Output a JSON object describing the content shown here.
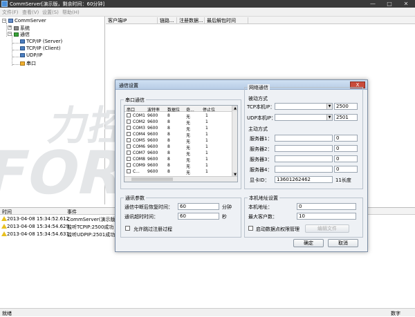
{
  "window": {
    "title": "CommServer[演示版，剩余时间：60分钟]",
    "minimize": "—",
    "maximize": "□",
    "close": "✕"
  },
  "menu": [
    "文件(F)",
    "查看(V)",
    "设置(S)",
    "帮助(H)"
  ],
  "tree": {
    "root": "CommServer",
    "system": "系统",
    "comm": "通信",
    "tcp_server": "TCP/IP (Server)",
    "tcp_client": "TCP/IP (Client)",
    "udp": "UDP/IP",
    "serial": "串口"
  },
  "client_list": {
    "columns": [
      "客户端IP",
      "链路...",
      "注册数据...",
      "最后解包时间"
    ]
  },
  "log": {
    "columns": [
      "时间",
      "事件"
    ],
    "rows": [
      {
        "time": "2013-04-08 15:34:52.612",
        "event": "CommServer(演示版，..."
      },
      {
        "time": "2013-04-08 15:34:54.629",
        "event": "监听TCPIP:2500成功"
      },
      {
        "time": "2013-04-08 15:34:54.631",
        "event": "监听UDPIP:2501成功"
      }
    ]
  },
  "status": {
    "left": "就绪",
    "right": "数字"
  },
  "watermark": {
    "text1": "力控科技",
    "text2": "FORCECON"
  },
  "dialog": {
    "title": "通信设置",
    "close": "X",
    "serial_group": "串口通信",
    "port_columns": [
      "串口",
      "波特率",
      "数据位",
      "奇...",
      "停止位"
    ],
    "ports": [
      {
        "name": "COM1",
        "baud": "9600",
        "data": "8",
        "parity": "无",
        "stop": "1"
      },
      {
        "name": "COM2",
        "baud": "9600",
        "data": "8",
        "parity": "无",
        "stop": "1"
      },
      {
        "name": "COM3",
        "baud": "9600",
        "data": "8",
        "parity": "无",
        "stop": "1"
      },
      {
        "name": "COM4",
        "baud": "9600",
        "data": "8",
        "parity": "无",
        "stop": "1"
      },
      {
        "name": "COM5",
        "baud": "9600",
        "data": "8",
        "parity": "无",
        "stop": "1"
      },
      {
        "name": "COM6",
        "baud": "9600",
        "data": "8",
        "parity": "无",
        "stop": "1"
      },
      {
        "name": "COM7",
        "baud": "9600",
        "data": "8",
        "parity": "无",
        "stop": "1"
      },
      {
        "name": "COM8",
        "baud": "9600",
        "data": "8",
        "parity": "无",
        "stop": "1"
      },
      {
        "name": "COM9",
        "baud": "9600",
        "data": "8",
        "parity": "无",
        "stop": "1"
      },
      {
        "name": "C...",
        "baud": "9600",
        "data": "8",
        "parity": "无",
        "stop": "1"
      }
    ],
    "net_group": "网络通信",
    "passive_label": "被动方式",
    "tcp_local_ip_label": "TCP本机IP：",
    "tcp_port": "2500",
    "udp_local_ip_label": "UDP本机IP：",
    "udp_port": "2501",
    "active_label": "主动方式",
    "servers": [
      {
        "label": "服务器1：",
        "port": "0"
      },
      {
        "label": "服务器2：",
        "port": "0"
      },
      {
        "label": "服务器3：",
        "port": "0"
      },
      {
        "label": "服务器4：",
        "port": "0"
      }
    ],
    "sms_label": "显卡ID：",
    "sms_value": "13601262462",
    "sms_len": "11长度",
    "comm_params_group": "通讯参数",
    "idle_timeout_label": "通信中断后恢复时间：",
    "idle_timeout_value": "60",
    "idle_timeout_unit": "分钟",
    "comm_timeout_label": "通讯超时时间：",
    "comm_timeout_value": "60",
    "comm_timeout_unit": "秒",
    "skip_register_label": "允许跳过注册过程",
    "local_addr_group": "本机地址设置",
    "local_addr_label": "本机地址：",
    "local_addr_value": "0",
    "max_clients_label": "最大客户数：",
    "max_clients_value": "10",
    "enable_db_label": "启动数据点权限管理",
    "edit_file_label": "编辑文件",
    "ok_label": "确定",
    "cancel_label": "取消"
  }
}
